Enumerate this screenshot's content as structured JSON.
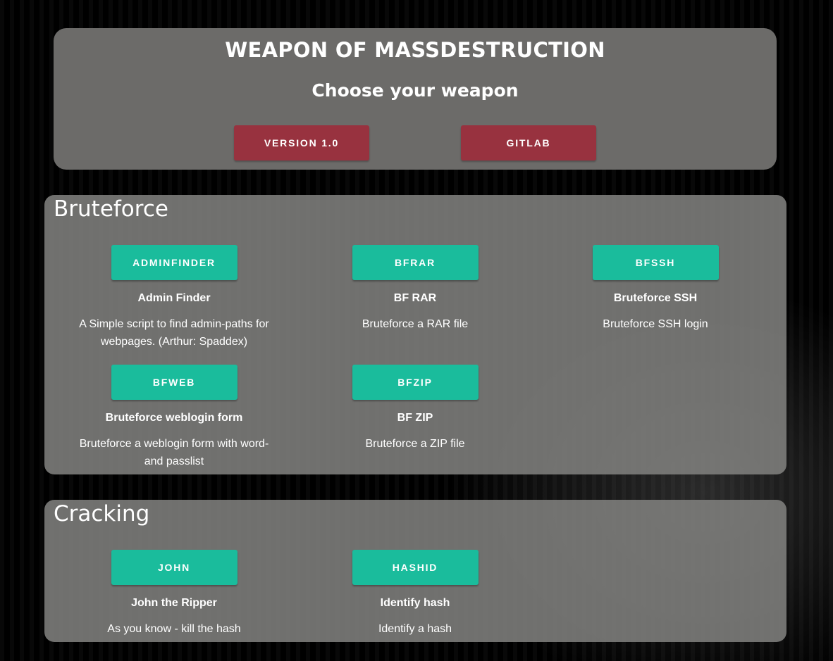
{
  "header": {
    "title": "WEAPON OF MASSDESTRUCTION",
    "subtitle": "Choose your weapon",
    "version_button": "VERSION 1.0",
    "gitlab_button": "GITLAB"
  },
  "sections": [
    {
      "title": "Bruteforce",
      "tools": [
        {
          "button": "ADMINFINDER",
          "name": "Admin Finder",
          "description": "A Simple script to find admin-paths for webpages. (Arthur: Spaddex)"
        },
        {
          "button": "BFRAR",
          "name": "BF RAR",
          "description": "Bruteforce a RAR file"
        },
        {
          "button": "BFSSH",
          "name": "Bruteforce SSH",
          "description": "Bruteforce SSH login"
        },
        {
          "button": "BFWEB",
          "name": "Bruteforce weblogin form",
          "description": "Bruteforce a weblogin form with word- and passlist"
        },
        {
          "button": "BFZIP",
          "name": "BF ZIP",
          "description": "Bruteforce a ZIP file"
        }
      ]
    },
    {
      "title": "Cracking",
      "tools": [
        {
          "button": "JOHN",
          "name": "John the Ripper",
          "description": "As you know - kill the hash"
        },
        {
          "button": "HASHID",
          "name": "Identify hash",
          "description": "Identify a hash"
        }
      ]
    }
  ],
  "colors": {
    "accent_green": "#1abc9c",
    "accent_red": "#98323f",
    "panel": "#6c6b69"
  }
}
